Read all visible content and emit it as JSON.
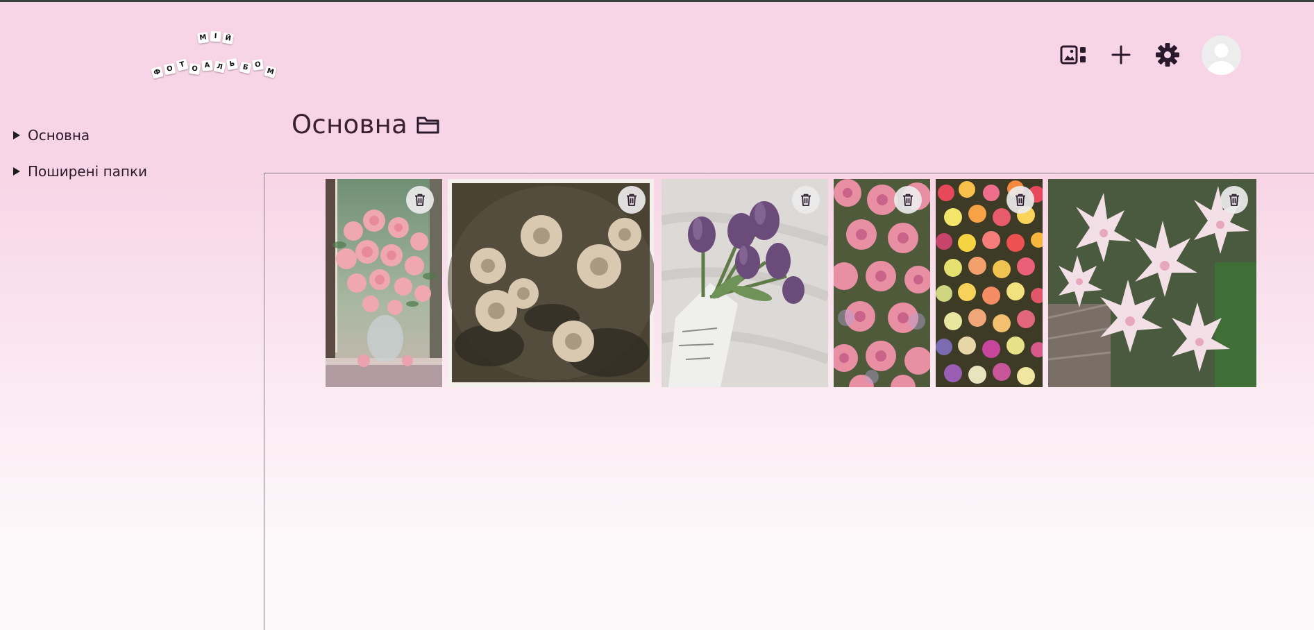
{
  "logo": {
    "line1": [
      "М",
      "І",
      "Й"
    ],
    "line2": [
      "Ф",
      "О",
      "Т",
      "О",
      "А",
      "Л",
      "Ь",
      "Б",
      "О",
      "М"
    ]
  },
  "header": {
    "icons": [
      "gallery-icon",
      "plus-icon",
      "gear-icon",
      "user-avatar"
    ]
  },
  "sidebar": {
    "items": [
      {
        "label": "Основна"
      },
      {
        "label": "Поширені папки"
      }
    ]
  },
  "main": {
    "title": "Основна",
    "title_icon": "folder-icon",
    "photos": [
      {
        "subject": "pink peonies in vase by window",
        "delete_icon": "trash-icon"
      },
      {
        "subject": "dark painting of white roses",
        "delete_icon": "trash-icon"
      },
      {
        "subject": "purple tulips on white sheet",
        "delete_icon": "trash-icon"
      },
      {
        "subject": "pink roses close-up",
        "delete_icon": "trash-icon"
      },
      {
        "subject": "colorful mixed flower market",
        "delete_icon": "trash-icon"
      },
      {
        "subject": "white-pink lilies",
        "delete_icon": "trash-icon"
      }
    ]
  },
  "colors": {
    "background_top": "#f8d5e6",
    "background_bottom": "#fdf9fb",
    "text": "#2b1a2e",
    "topline": "#37403a"
  }
}
